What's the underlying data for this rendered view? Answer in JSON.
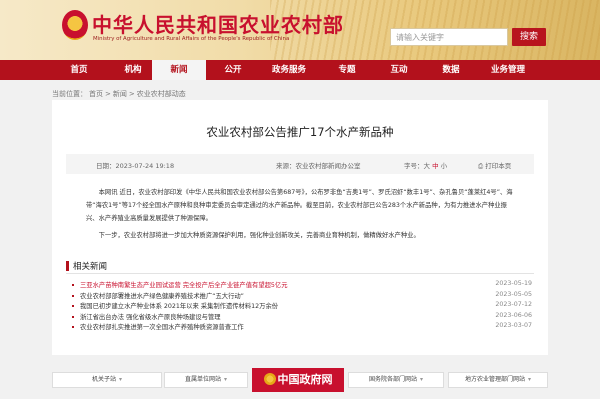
{
  "header": {
    "title": "中华人民共和国农业农村部",
    "subtitle": "Ministry of Agriculture and Rural Affairs of the People's Republic of China",
    "search_placeholder": "请输入关键字",
    "search_button": "搜索"
  },
  "nav": {
    "items": [
      {
        "label": "首页"
      },
      {
        "label": "机构"
      },
      {
        "label": "新闻"
      },
      {
        "label": "公开"
      },
      {
        "label": "政务服务"
      },
      {
        "label": "专题"
      },
      {
        "label": "互动"
      },
      {
        "label": "数据"
      },
      {
        "label": "业务管理"
      }
    ],
    "active": "新闻"
  },
  "breadcrumb": {
    "prefix": "当前位置：",
    "items": [
      "首页",
      ">",
      "新闻",
      ">",
      "农业农村部动态"
    ]
  },
  "article": {
    "title": "农业农村部公告推广17个水产新品种",
    "date_label": "日期：",
    "date": "2023-07-24 19:18",
    "source_label": "来源：",
    "source": "农业农村部新闻办公室",
    "font_label": "字号：",
    "font_large": "大",
    "font_medium": "中",
    "font_small": "小",
    "print": "打印本页",
    "paragraphs": [
      "本网讯 近日，农业农村部印发《中华人民共和国农业农村部公告第687号》，公布罗非鱼“吉奥1号”、罗氏沼虾“数丰1号”、杂孔鲁贝“蓬莱红4号”、海带“海农1号”等17个经全国水产原种和良种审定委员会审定通过的水产新品种。截至目前，农业农村部已公告283个水产新品种，为有力推进水产种业振兴、水产养殖业高质量发展提供了种源保障。",
      "下一步，农业农村部将进一步加大种质资源保护利用，强化种业创新攻关，完善商业育种机制，做精做好水产种业。"
    ]
  },
  "related": {
    "heading": "相关新闻",
    "items": [
      {
        "title": "三亚水产苗种南繁生态产业园试运营 完全投产后全产业链产值有望超5亿元",
        "date": "2023-05-19",
        "highlight": true
      },
      {
        "title": "农业农村部部署推进水产绿色健康养殖技术推广“五大行动”",
        "date": "2023-05-05",
        "highlight": false
      },
      {
        "title": "我国已初步建立水产种业体系 2021年以来 采集制作遗传材料12万余份",
        "date": "2023-07-12",
        "highlight": false
      },
      {
        "title": "浙江省出台办法 强化省级水产原良种场建设与管理",
        "date": "2023-06-06",
        "highlight": false
      },
      {
        "title": "农业农村部扎实推进第一次全国水产养殖种质资源普查工作",
        "date": "2023-03-07",
        "highlight": false
      }
    ]
  },
  "footer": {
    "links": [
      "机关子站",
      "直属单位网站",
      "国务院各部门网站",
      "地方农业管理部门网站"
    ],
    "gov": "中国政府网"
  }
}
